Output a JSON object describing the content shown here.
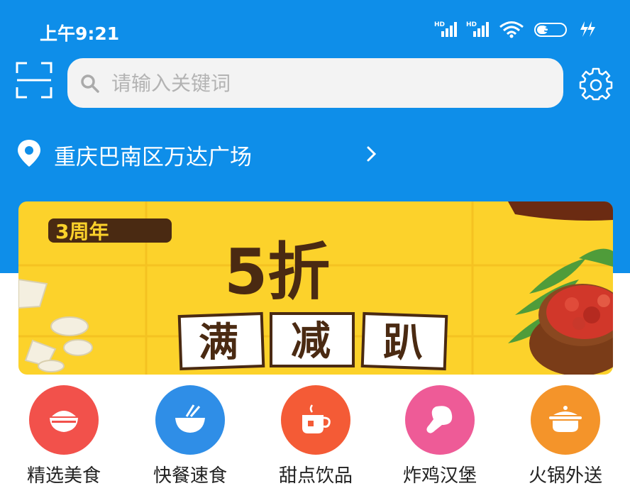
{
  "status_bar": {
    "time": "上午9:21",
    "signal_label_1": "HD",
    "signal_label_2": "HD",
    "battery": "35"
  },
  "search": {
    "placeholder": "请输入关键词"
  },
  "location": {
    "text": "重庆巴南区万达广场"
  },
  "banner": {
    "badge": "3周年",
    "headline": "5折",
    "slogan": [
      "满",
      "减",
      "趴"
    ]
  },
  "categories": [
    {
      "label": "精选美食",
      "color": "#f2514b",
      "icon": "rice-bowl-icon"
    },
    {
      "label": "快餐速食",
      "color": "#2f8ee7",
      "icon": "noodle-bowl-icon"
    },
    {
      "label": "甜点饮品",
      "color": "#f45b36",
      "icon": "tea-cup-icon"
    },
    {
      "label": "炸鸡汉堡",
      "color": "#ee5b97",
      "icon": "drumstick-icon"
    },
    {
      "label": "火锅外送",
      "color": "#f4942a",
      "icon": "hotpot-icon"
    }
  ],
  "colors": {
    "header_blue": "#0e8ee9",
    "banner_yellow": "#fcd22b",
    "banner_text": "#4a2a12"
  }
}
